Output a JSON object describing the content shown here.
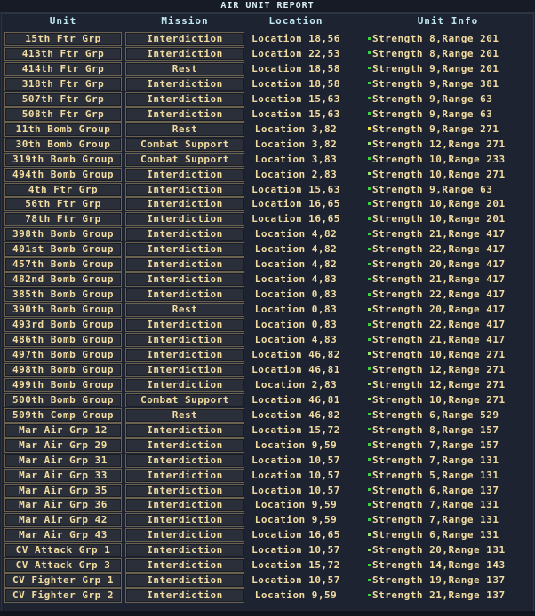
{
  "window": {
    "title": "AIR UNIT REPORT"
  },
  "headers": {
    "unit": "Unit",
    "mission": "Mission",
    "location": "Location",
    "info": "Unit Info"
  },
  "colors": {
    "status_green": "#3ed23e",
    "status_light_green": "#9be86a",
    "status_yellow": "#f0e040",
    "text": "#f2dca0",
    "header": "#bfe6f0"
  },
  "rows": [
    {
      "unit": "15th Ftr Grp",
      "mission": "Interdiction",
      "location": "Location 18,56",
      "info": "Strength 8,Range 201",
      "status": "green"
    },
    {
      "unit": "413th Ftr Grp",
      "mission": "Interdiction",
      "location": "Location 22,53",
      "info": "Strength 8,Range 201",
      "status": "green"
    },
    {
      "unit": "414th Ftr Grp",
      "mission": "Rest",
      "location": "Location 18,58",
      "info": "Strength 9,Range 201",
      "status": "green"
    },
    {
      "unit": "318th Ftr Grp",
      "mission": "Interdiction",
      "location": "Location 18,58",
      "info": "Strength 9,Range 381",
      "status": "green"
    },
    {
      "unit": "507th Ftr Grp",
      "mission": "Interdiction",
      "location": "Location 15,63",
      "info": "Strength 9,Range 63",
      "status": "green"
    },
    {
      "unit": "508th Ftr Grp",
      "mission": "Interdiction",
      "location": "Location 15,63",
      "info": "Strength 9,Range 63",
      "status": "green"
    },
    {
      "unit": "11th Bomb Group",
      "mission": "Rest",
      "location": "Location 3,82",
      "info": "Strength 9,Range 271",
      "status": "yellow"
    },
    {
      "unit": "30th Bomb Group",
      "mission": "Combat Support",
      "location": "Location 3,82",
      "info": "Strength 12,Range 271",
      "status": "light"
    },
    {
      "unit": "319th Bomb Group",
      "mission": "Combat Support",
      "location": "Location 3,83",
      "info": "Strength 10,Range 233",
      "status": "green"
    },
    {
      "unit": "494th Bomb Group",
      "mission": "Interdiction",
      "location": "Location 2,83",
      "info": "Strength 10,Range 271",
      "status": "light"
    },
    {
      "unit": "4th Ftr Grp",
      "mission": "Interdiction",
      "location": "Location 15,63",
      "info": "Strength 9,Range 63",
      "status": "green"
    },
    {
      "unit": "56th Ftr Grp",
      "mission": "Interdiction",
      "location": "Location 16,65",
      "info": "Strength 10,Range 201",
      "status": "green"
    },
    {
      "unit": "78th Ftr Grp",
      "mission": "Interdiction",
      "location": "Location 16,65",
      "info": "Strength 10,Range 201",
      "status": "green"
    },
    {
      "unit": "398th Bomb Group",
      "mission": "Interdiction",
      "location": "Location 4,82",
      "info": "Strength 21,Range 417",
      "status": "green"
    },
    {
      "unit": "401st Bomb Group",
      "mission": "Interdiction",
      "location": "Location 4,82",
      "info": "Strength 22,Range 417",
      "status": "green"
    },
    {
      "unit": "457th Bomb Group",
      "mission": "Interdiction",
      "location": "Location 4,82",
      "info": "Strength 20,Range 417",
      "status": "green"
    },
    {
      "unit": "482nd Bomb Group",
      "mission": "Interdiction",
      "location": "Location 4,83",
      "info": "Strength 21,Range 417",
      "status": "green"
    },
    {
      "unit": "385th Bomb Group",
      "mission": "Interdiction",
      "location": "Location 0,83",
      "info": "Strength 22,Range 417",
      "status": "green"
    },
    {
      "unit": "390th Bomb Group",
      "mission": "Rest",
      "location": "Location 0,83",
      "info": "Strength 20,Range 417",
      "status": "light"
    },
    {
      "unit": "493rd Bomb Group",
      "mission": "Interdiction",
      "location": "Location 0,83",
      "info": "Strength 22,Range 417",
      "status": "green"
    },
    {
      "unit": "486th Bomb Group",
      "mission": "Interdiction",
      "location": "Location 4,83",
      "info": "Strength 21,Range 417",
      "status": "green"
    },
    {
      "unit": "497th Bomb Group",
      "mission": "Interdiction",
      "location": "Location 46,82",
      "info": "Strength 10,Range 271",
      "status": "light"
    },
    {
      "unit": "498th Bomb Group",
      "mission": "Interdiction",
      "location": "Location 46,81",
      "info": "Strength 12,Range 271",
      "status": "green"
    },
    {
      "unit": "499th Bomb Group",
      "mission": "Interdiction",
      "location": "Location 2,83",
      "info": "Strength 12,Range 271",
      "status": "light"
    },
    {
      "unit": "500th Bomb Group",
      "mission": "Combat Support",
      "location": "Location 46,81",
      "info": "Strength 10,Range 271",
      "status": "light"
    },
    {
      "unit": "509th Comp Group",
      "mission": "Rest",
      "location": "Location 46,82",
      "info": "Strength 6,Range 529",
      "status": "green"
    },
    {
      "unit": "Mar Air Grp 12",
      "mission": "Interdiction",
      "location": "Location 15,72",
      "info": "Strength 8,Range 157",
      "status": "green"
    },
    {
      "unit": "Mar Air Grp 29",
      "mission": "Interdiction",
      "location": "Location 9,59",
      "info": "Strength 7,Range 157",
      "status": "green"
    },
    {
      "unit": "Mar Air Grp 31",
      "mission": "Interdiction",
      "location": "Location 10,57",
      "info": "Strength 7,Range 131",
      "status": "green"
    },
    {
      "unit": "Mar Air Grp 33",
      "mission": "Interdiction",
      "location": "Location 10,57",
      "info": "Strength 5,Range 131",
      "status": "green"
    },
    {
      "unit": "Mar Air Grp 35",
      "mission": "Interdiction",
      "location": "Location 10,57",
      "info": "Strength 6,Range 137",
      "status": "green"
    },
    {
      "unit": "Mar Air Grp 36",
      "mission": "Interdiction",
      "location": "Location 9,59",
      "info": "Strength 7,Range 131",
      "status": "green"
    },
    {
      "unit": "Mar Air Grp 42",
      "mission": "Interdiction",
      "location": "Location 9,59",
      "info": "Strength 7,Range 131",
      "status": "green"
    },
    {
      "unit": "Mar Air Grp 43",
      "mission": "Interdiction",
      "location": "Location 16,65",
      "info": "Strength 6,Range 131",
      "status": "light"
    },
    {
      "unit": "CV Attack Grp 1",
      "mission": "Interdiction",
      "location": "Location 10,57",
      "info": "Strength 20,Range 131",
      "status": "light"
    },
    {
      "unit": "CV Attack Grp 3",
      "mission": "Interdiction",
      "location": "Location 15,72",
      "info": "Strength 14,Range 143",
      "status": "green"
    },
    {
      "unit": "CV Fighter Grp 1",
      "mission": "Interdiction",
      "location": "Location 10,57",
      "info": "Strength 19,Range 137",
      "status": "green"
    },
    {
      "unit": "CV Fighter Grp 2",
      "mission": "Interdiction",
      "location": "Location 9,59",
      "info": "Strength 21,Range 137",
      "status": "green"
    }
  ]
}
